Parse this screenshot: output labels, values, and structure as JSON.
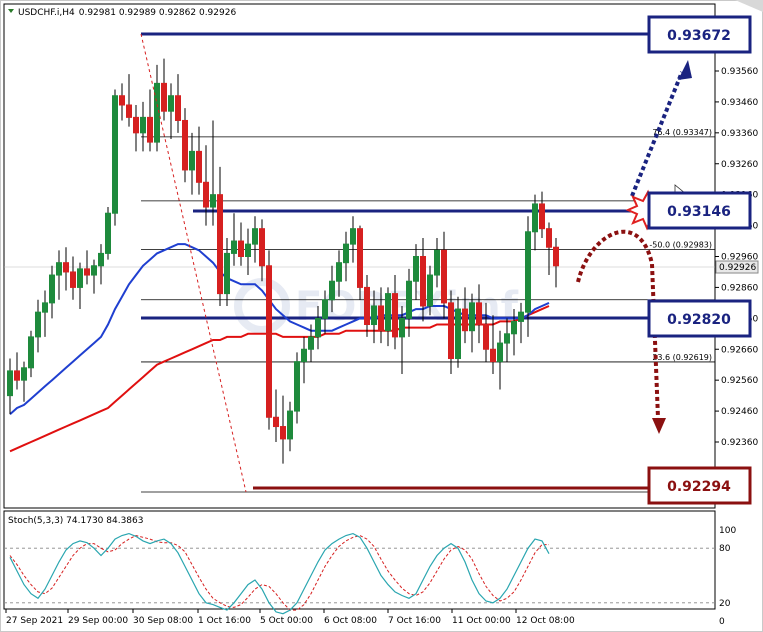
{
  "header": {
    "symbol": "USDCHF.i,H4",
    "ohlc": "0.92981 0.92989 0.92862 0.92926"
  },
  "stoch_label": "Stoch(5,3,3) 74.1730 84.3863",
  "current_price_label": "0.92926",
  "callouts": {
    "top": "0.93672",
    "mid": "0.93146",
    "support": "0.92820",
    "bottom": "0.92294"
  },
  "fib_labels": [
    {
      "text": "76.4 (0.93347)",
      "price": 0.93347
    },
    {
      "text": "-50.0 (0.92983)",
      "price": 0.92983
    },
    {
      "text": "23.6 (0.92619)",
      "price": 0.92619
    }
  ],
  "x_labels": [
    "27 Sep 2021",
    "29 Sep 00:00",
    "30 Sep 08:00",
    "1 Oct 16:00",
    "5 Oct 00:00",
    "6 Oct 08:00",
    "7 Oct 16:00",
    "11 Oct 00:00",
    "12 Oct 08:00"
  ],
  "stoch_levels": [
    "100",
    "80",
    "20",
    "0"
  ],
  "colors": {
    "bull": "#1e8a3c",
    "bear": "#d62020",
    "ma_fast": "#1f3fd0",
    "ma_slow": "#e01010",
    "callout_blue": "#1a2380",
    "callout_red": "#8b1010",
    "stoch_main": "#2aa6b0",
    "stoch_signal": "#d62020"
  },
  "chart_data": {
    "type": "candlestick",
    "symbol": "USDCHF.i",
    "timeframe": "H4",
    "ylim": [
      0.92294,
      0.93672
    ],
    "y_ticks": [
      0.9356,
      0.9346,
      0.9336,
      0.9326,
      0.9316,
      0.9306,
      0.9296,
      0.9286,
      0.9276,
      0.9266,
      0.9256,
      0.9246,
      0.9236
    ],
    "y_tick_labels": [
      "0.93560",
      "0.93460",
      "0.93360",
      "0.93260",
      "0.93160",
      "0.93060",
      "0.92960",
      "0.92860",
      "0.92760",
      "0.92660",
      "0.92560",
      "0.92460",
      "0.92360"
    ],
    "last_price": 0.92926,
    "levels": [
      {
        "name": "resistance-top",
        "price": 0.93672
      },
      {
        "name": "resistance",
        "price": 0.93146
      },
      {
        "name": "support",
        "price": 0.9282
      },
      {
        "name": "support-bottom",
        "price": 0.92294
      }
    ],
    "fib_levels": [
      {
        "label": "76.4",
        "price": 0.93347
      },
      {
        "label": "-50.0",
        "price": 0.92983
      },
      {
        "label": "23.6",
        "price": 0.92619
      }
    ],
    "candles": [
      [
        0.9251,
        0.9263,
        0.9245,
        0.9259
      ],
      [
        0.9259,
        0.9265,
        0.9253,
        0.9256
      ],
      [
        0.9256,
        0.9262,
        0.9249,
        0.926
      ],
      [
        0.926,
        0.9272,
        0.9257,
        0.927
      ],
      [
        0.927,
        0.9282,
        0.9265,
        0.9278
      ],
      [
        0.9278,
        0.9285,
        0.927,
        0.9281
      ],
      [
        0.9281,
        0.9293,
        0.9276,
        0.929
      ],
      [
        0.929,
        0.9298,
        0.9282,
        0.9294
      ],
      [
        0.9294,
        0.9299,
        0.9285,
        0.9291
      ],
      [
        0.9291,
        0.9296,
        0.9282,
        0.9286
      ],
      [
        0.9286,
        0.9294,
        0.9279,
        0.9292
      ],
      [
        0.9292,
        0.9298,
        0.9287,
        0.929
      ],
      [
        0.929,
        0.9295,
        0.9284,
        0.9293
      ],
      [
        0.9293,
        0.93,
        0.9287,
        0.9297
      ],
      [
        0.9297,
        0.9312,
        0.9295,
        0.931
      ],
      [
        0.931,
        0.935,
        0.9306,
        0.9348
      ],
      [
        0.9348,
        0.9352,
        0.934,
        0.9345
      ],
      [
        0.9345,
        0.9355,
        0.9338,
        0.9341
      ],
      [
        0.9341,
        0.9345,
        0.933,
        0.9336
      ],
      [
        0.9336,
        0.9346,
        0.933,
        0.9341
      ],
      [
        0.9341,
        0.935,
        0.933,
        0.9333
      ],
      [
        0.9333,
        0.9358,
        0.933,
        0.9352
      ],
      [
        0.9352,
        0.936,
        0.934,
        0.9343
      ],
      [
        0.9343,
        0.9352,
        0.9334,
        0.9348
      ],
      [
        0.9348,
        0.9355,
        0.9336,
        0.934
      ],
      [
        0.934,
        0.9344,
        0.932,
        0.9324
      ],
      [
        0.9324,
        0.9336,
        0.9316,
        0.933
      ],
      [
        0.933,
        0.9338,
        0.9316,
        0.932
      ],
      [
        0.932,
        0.9332,
        0.9306,
        0.9312
      ],
      [
        0.9312,
        0.934,
        0.9306,
        0.9316
      ],
      [
        0.9316,
        0.9325,
        0.928,
        0.9284
      ],
      [
        0.9284,
        0.9302,
        0.928,
        0.9297
      ],
      [
        0.9297,
        0.931,
        0.9293,
        0.9301
      ],
      [
        0.9301,
        0.9307,
        0.9293,
        0.9296
      ],
      [
        0.9296,
        0.9305,
        0.929,
        0.93
      ],
      [
        0.93,
        0.9309,
        0.9294,
        0.9305
      ],
      [
        0.9305,
        0.9308,
        0.9288,
        0.9293
      ],
      [
        0.9293,
        0.9298,
        0.924,
        0.9244
      ],
      [
        0.9244,
        0.9253,
        0.9236,
        0.9241
      ],
      [
        0.9241,
        0.9251,
        0.9229,
        0.9237
      ],
      [
        0.9237,
        0.9249,
        0.9233,
        0.9246
      ],
      [
        0.9246,
        0.9265,
        0.9242,
        0.9262
      ],
      [
        0.9262,
        0.927,
        0.9255,
        0.9266
      ],
      [
        0.9266,
        0.9274,
        0.9262,
        0.927
      ],
      [
        0.927,
        0.928,
        0.9266,
        0.9276
      ],
      [
        0.9276,
        0.9285,
        0.9271,
        0.9282
      ],
      [
        0.9282,
        0.9293,
        0.9278,
        0.9288
      ],
      [
        0.9288,
        0.9298,
        0.9283,
        0.9294
      ],
      [
        0.9294,
        0.9304,
        0.9288,
        0.93
      ],
      [
        0.93,
        0.9309,
        0.9294,
        0.9305
      ],
      [
        0.9305,
        0.9306,
        0.9282,
        0.9286
      ],
      [
        0.9286,
        0.929,
        0.927,
        0.9274
      ],
      [
        0.9274,
        0.9285,
        0.9268,
        0.928
      ],
      [
        0.928,
        0.9286,
        0.9268,
        0.9272
      ],
      [
        0.9272,
        0.9286,
        0.9267,
        0.9284
      ],
      [
        0.9284,
        0.929,
        0.9266,
        0.927
      ],
      [
        0.927,
        0.928,
        0.9258,
        0.9276
      ],
      [
        0.9276,
        0.9292,
        0.927,
        0.9288
      ],
      [
        0.9288,
        0.93,
        0.9282,
        0.9296
      ],
      [
        0.9296,
        0.9302,
        0.9275,
        0.928
      ],
      [
        0.928,
        0.9293,
        0.9277,
        0.929
      ],
      [
        0.929,
        0.9302,
        0.9286,
        0.9298
      ],
      [
        0.9298,
        0.9304,
        0.9276,
        0.9281
      ],
      [
        0.9281,
        0.9285,
        0.9258,
        0.9263
      ],
      [
        0.9263,
        0.9283,
        0.926,
        0.9279
      ],
      [
        0.9279,
        0.9286,
        0.9268,
        0.9272
      ],
      [
        0.9272,
        0.9284,
        0.9265,
        0.9281
      ],
      [
        0.9281,
        0.9287,
        0.9268,
        0.9274
      ],
      [
        0.9274,
        0.9281,
        0.9262,
        0.9266
      ],
      [
        0.9266,
        0.9277,
        0.9258,
        0.9262
      ],
      [
        0.9262,
        0.9272,
        0.9253,
        0.9268
      ],
      [
        0.9268,
        0.9276,
        0.9262,
        0.9271
      ],
      [
        0.9271,
        0.9279,
        0.9264,
        0.9275
      ],
      [
        0.9275,
        0.9281,
        0.9268,
        0.9278
      ],
      [
        0.9278,
        0.9309,
        0.927,
        0.9304
      ],
      [
        0.9304,
        0.9316,
        0.9298,
        0.9313
      ],
      [
        0.9313,
        0.9317,
        0.9302,
        0.9305
      ],
      [
        0.9305,
        0.9307,
        0.929,
        0.9299
      ],
      [
        0.9299,
        0.9302,
        0.9286,
        0.9293
      ]
    ],
    "ma_fast": [
      0.9245,
      0.9247,
      0.9248,
      0.925,
      0.9252,
      0.9254,
      0.9256,
      0.9258,
      0.926,
      0.9262,
      0.9264,
      0.9266,
      0.9268,
      0.927,
      0.9274,
      0.9279,
      0.9283,
      0.9287,
      0.929,
      0.9293,
      0.9295,
      0.9297,
      0.9298,
      0.9299,
      0.93,
      0.93,
      0.9299,
      0.9298,
      0.9296,
      0.9294,
      0.9291,
      0.9289,
      0.9288,
      0.9287,
      0.9287,
      0.9287,
      0.9285,
      0.9282,
      0.9279,
      0.9277,
      0.9275,
      0.9274,
      0.9273,
      0.9272,
      0.9272,
      0.9272,
      0.9272,
      0.9273,
      0.9274,
      0.9275,
      0.9276,
      0.9276,
      0.9276,
      0.9277,
      0.9277,
      0.9277,
      0.9277,
      0.9278,
      0.9279,
      0.9279,
      0.928,
      0.928,
      0.928,
      0.9279,
      0.9278,
      0.9277,
      0.9277,
      0.9277,
      0.9277,
      0.9276,
      0.9276,
      0.9276,
      0.9276,
      0.9276,
      0.9277,
      0.9279,
      0.928,
      0.9281
    ],
    "ma_slow": [
      0.9233,
      0.9234,
      0.9235,
      0.9236,
      0.9237,
      0.9238,
      0.9239,
      0.924,
      0.9241,
      0.9242,
      0.9243,
      0.9244,
      0.9245,
      0.9246,
      0.9247,
      0.9249,
      0.9251,
      0.9253,
      0.9255,
      0.9257,
      0.9259,
      0.9261,
      0.9262,
      0.9263,
      0.9264,
      0.9265,
      0.9266,
      0.9267,
      0.9268,
      0.9269,
      0.9269,
      0.927,
      0.927,
      0.927,
      0.9271,
      0.9271,
      0.9271,
      0.9271,
      0.9271,
      0.927,
      0.927,
      0.927,
      0.927,
      0.927,
      0.927,
      0.9271,
      0.9271,
      0.9271,
      0.9272,
      0.9272,
      0.9272,
      0.9272,
      0.9272,
      0.9272,
      0.9272,
      0.9272,
      0.9273,
      0.9273,
      0.9273,
      0.9273,
      0.9273,
      0.9274,
      0.9274,
      0.9274,
      0.9274,
      0.9274,
      0.9274,
      0.9274,
      0.9274,
      0.9274,
      0.9275,
      0.9275,
      0.9275,
      0.9276,
      0.9277,
      0.9278,
      0.9279,
      0.928
    ],
    "stochastic": {
      "name": "Stoch(5,3,3)",
      "k_last": 74.173,
      "d_last": 84.3863,
      "levels": [
        100,
        80,
        20,
        0
      ],
      "k": [
        70,
        55,
        40,
        30,
        25,
        35,
        50,
        65,
        78,
        85,
        88,
        86,
        80,
        72,
        80,
        90,
        94,
        96,
        93,
        88,
        85,
        88,
        90,
        85,
        75,
        60,
        45,
        30,
        20,
        18,
        15,
        12,
        20,
        30,
        40,
        45,
        35,
        20,
        10,
        8,
        12,
        20,
        35,
        50,
        65,
        78,
        85,
        90,
        94,
        96,
        92,
        80,
        65,
        50,
        40,
        32,
        28,
        25,
        30,
        45,
        60,
        72,
        80,
        85,
        80,
        65,
        45,
        30,
        22,
        20,
        25,
        35,
        50,
        65,
        80,
        90,
        88,
        74
      ],
      "d": [
        72,
        62,
        50,
        40,
        32,
        30,
        36,
        48,
        60,
        72,
        80,
        85,
        85,
        80,
        76,
        78,
        85,
        90,
        94,
        92,
        90,
        87,
        86,
        86,
        83,
        76,
        62,
        48,
        35,
        25,
        20,
        16,
        15,
        18,
        26,
        35,
        40,
        38,
        30,
        20,
        12,
        12,
        18,
        30,
        45,
        60,
        72,
        82,
        88,
        92,
        94,
        90,
        82,
        68,
        55,
        45,
        36,
        30,
        28,
        32,
        42,
        55,
        68,
        78,
        82,
        78,
        68,
        52,
        38,
        28,
        22,
        25,
        32,
        45,
        60,
        75,
        84,
        84
      ]
    }
  }
}
